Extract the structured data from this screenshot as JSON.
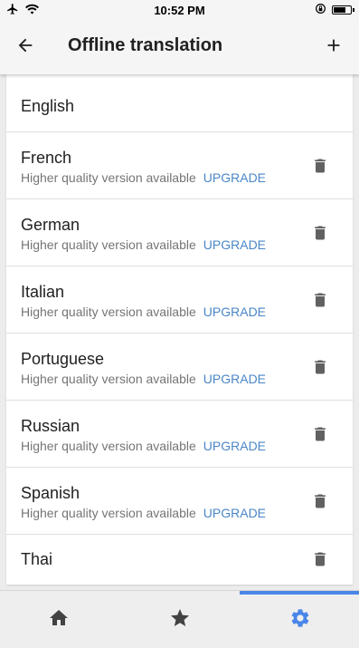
{
  "status_bar": {
    "time": "10:52 PM",
    "icons": [
      "airplane-icon",
      "wifi-icon",
      "orientation-lock-icon",
      "battery-icon"
    ]
  },
  "app_bar": {
    "title": "Offline translation",
    "back_icon": "arrow-left-icon",
    "add_icon": "plus-icon"
  },
  "languages": [
    {
      "name": "English",
      "subtitle": "",
      "upgrade_label": "",
      "deletable": false
    },
    {
      "name": "French",
      "subtitle": "Higher quality version available",
      "upgrade_label": "UPGRADE",
      "deletable": true
    },
    {
      "name": "German",
      "subtitle": "Higher quality version available",
      "upgrade_label": "UPGRADE",
      "deletable": true
    },
    {
      "name": "Italian",
      "subtitle": "Higher quality version available",
      "upgrade_label": "UPGRADE",
      "deletable": true
    },
    {
      "name": "Portuguese",
      "subtitle": "Higher quality version available",
      "upgrade_label": "UPGRADE",
      "deletable": true
    },
    {
      "name": "Russian",
      "subtitle": "Higher quality version available",
      "upgrade_label": "UPGRADE",
      "deletable": true
    },
    {
      "name": "Spanish",
      "subtitle": "Higher quality version available",
      "upgrade_label": "UPGRADE",
      "deletable": true
    },
    {
      "name": "Thai",
      "subtitle": "",
      "upgrade_label": "",
      "deletable": true
    }
  ],
  "bottom_nav": {
    "items": [
      {
        "icon": "home-icon",
        "selected": false
      },
      {
        "icon": "star-icon",
        "selected": false
      },
      {
        "icon": "gear-icon",
        "selected": true
      }
    ]
  },
  "colors": {
    "accent": "#4a86e8",
    "upgrade_link": "#4a86c7",
    "icon_gray": "#616161",
    "nav_icon": "#424242"
  }
}
